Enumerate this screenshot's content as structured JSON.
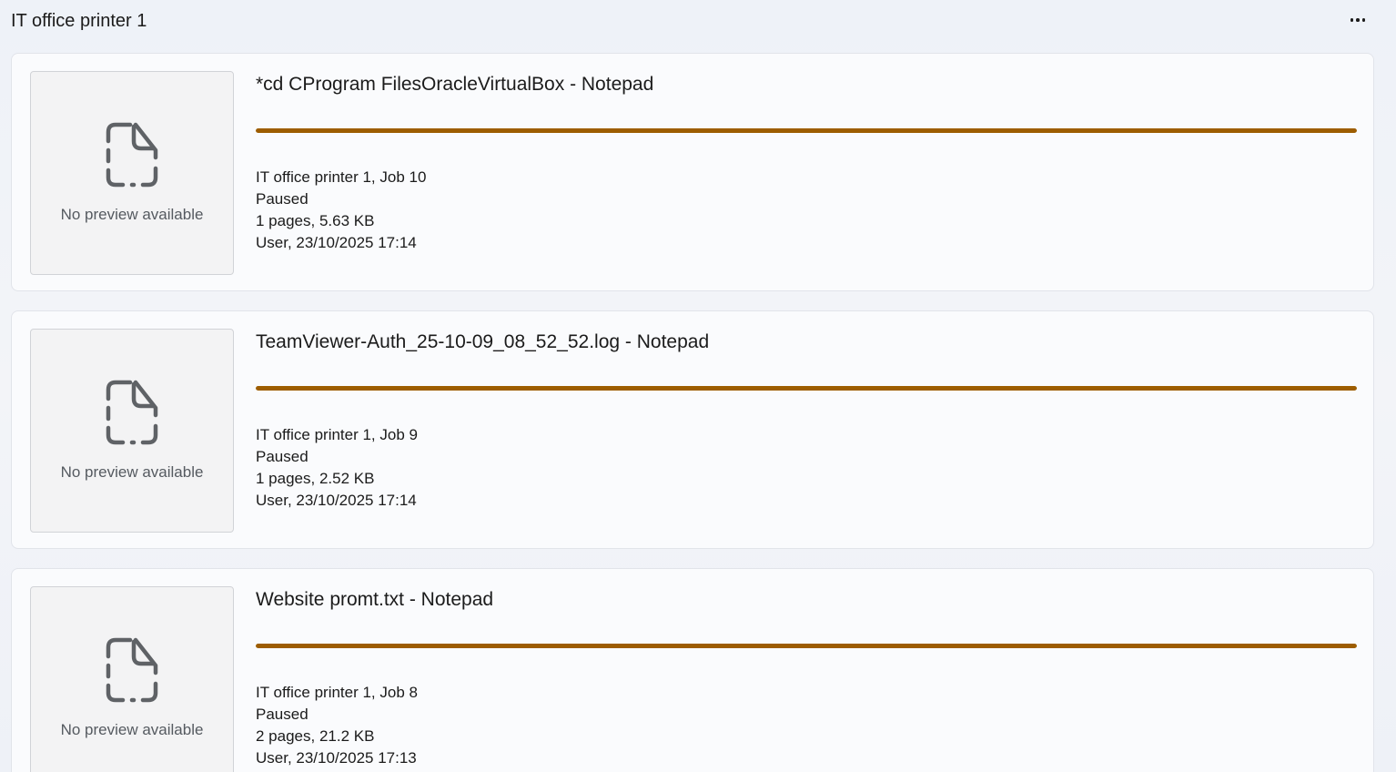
{
  "header": {
    "title": "IT office printer 1",
    "more_icon": "more-horizontal-icon"
  },
  "colors": {
    "progress": "#9d5d00",
    "card_background": "#fafbfd",
    "preview_background": "#f3f3f4"
  },
  "jobs": [
    {
      "title": "*cd CProgram FilesOracleVirtualBox - Notepad",
      "preview_text": "No preview available",
      "preview_icon": "document-placeholder-icon",
      "progress": 1.0,
      "printer_job": "IT office printer 1, Job 10",
      "status": "Paused",
      "size": "1 pages, 5.63 KB",
      "owner_time": "User, 23/10/2025 17:14"
    },
    {
      "title": "TeamViewer-Auth_25-10-09_08_52_52.log - Notepad",
      "preview_text": "No preview available",
      "preview_icon": "document-placeholder-icon",
      "progress": 1.0,
      "printer_job": "IT office printer 1, Job 9",
      "status": "Paused",
      "size": "1 pages, 2.52 KB",
      "owner_time": "User, 23/10/2025 17:14"
    },
    {
      "title": "Website promt.txt - Notepad",
      "preview_text": "No preview available",
      "preview_icon": "document-placeholder-icon",
      "progress": 1.0,
      "printer_job": "IT office printer 1, Job 8",
      "status": "Paused",
      "size": "2 pages, 21.2 KB",
      "owner_time": "User, 23/10/2025 17:13"
    }
  ]
}
